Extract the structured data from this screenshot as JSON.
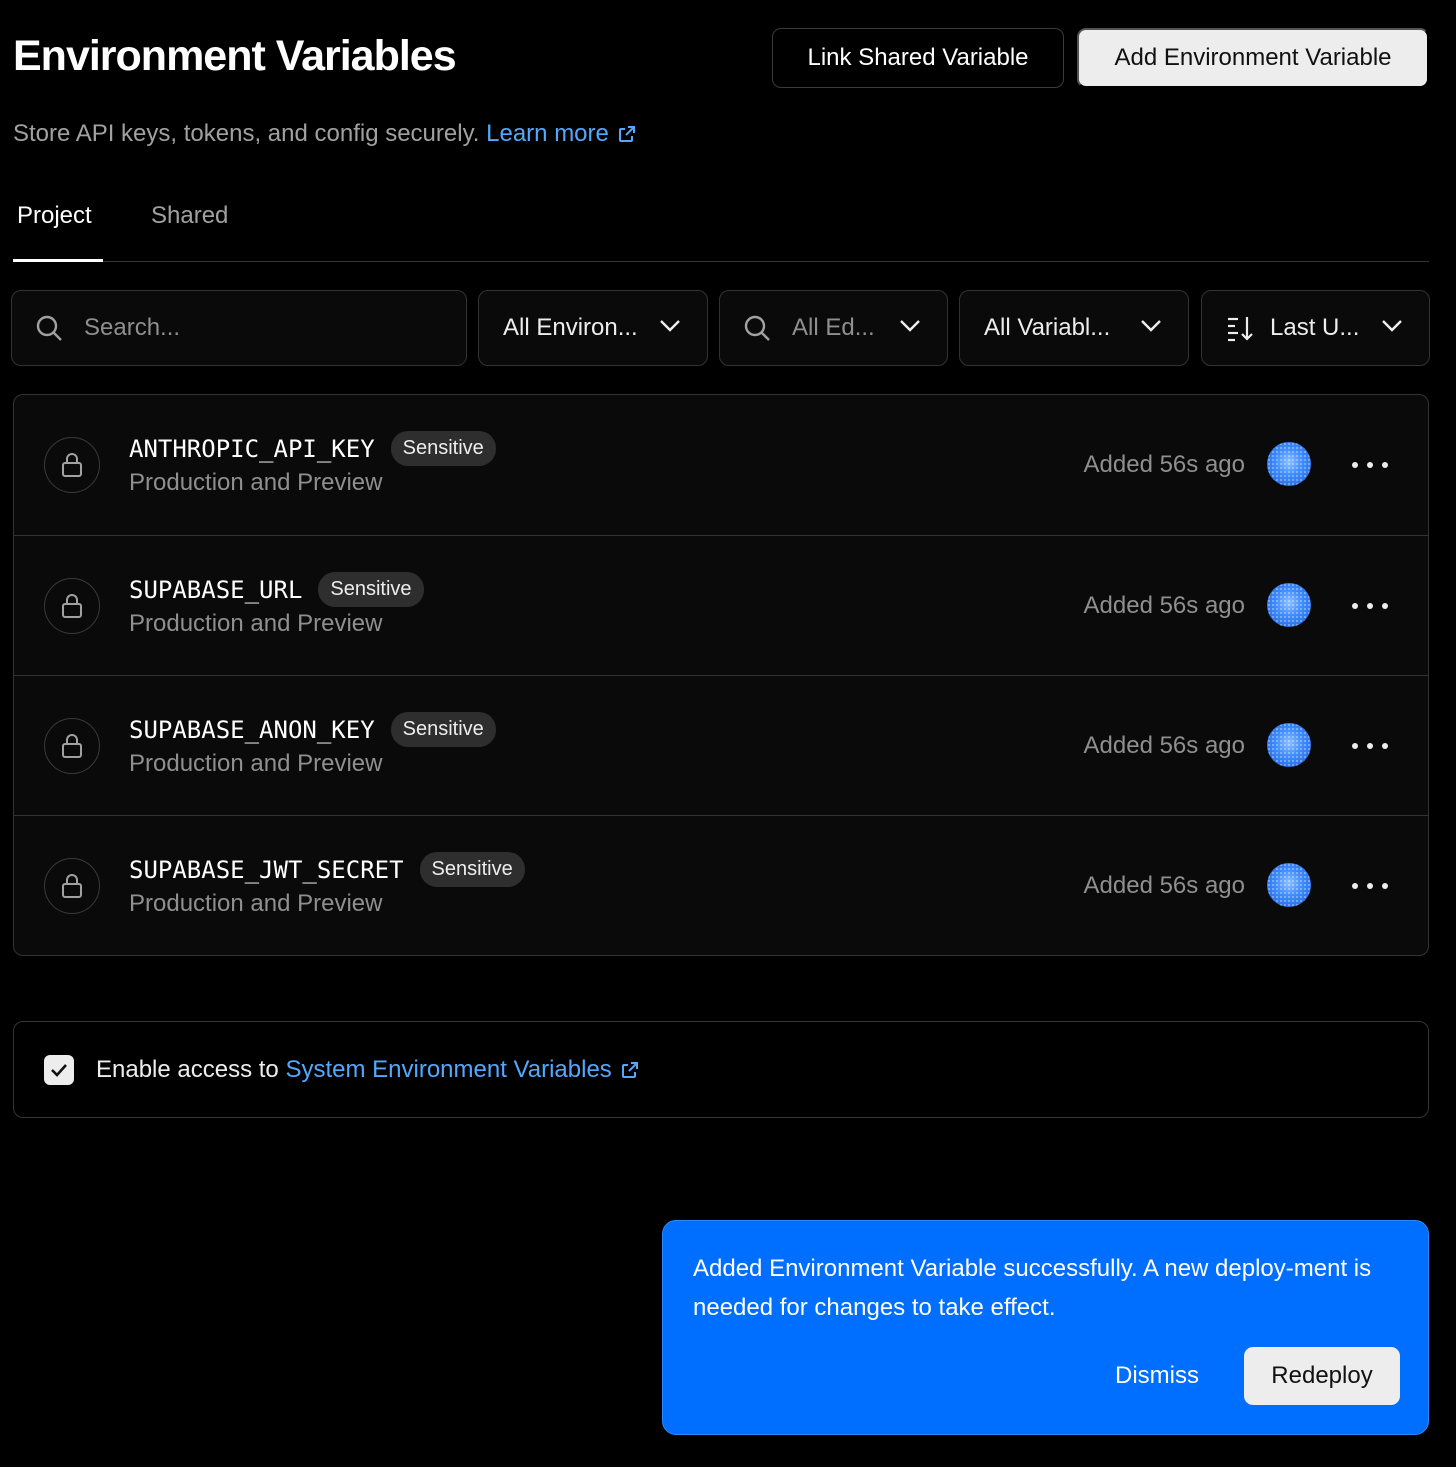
{
  "header": {
    "title": "Environment Variables",
    "link_shared_label": "Link Shared Variable",
    "add_label": "Add Environment Variable",
    "subtitle": "Store API keys, tokens, and config securely.",
    "learn_more": "Learn more"
  },
  "tabs": [
    {
      "label": "Project",
      "active": true
    },
    {
      "label": "Shared",
      "active": false
    }
  ],
  "filters": {
    "search_placeholder": "Search...",
    "environment": "All Environ...",
    "edge": "All Ed...",
    "variables": "All Variabl...",
    "sort": "Last U..."
  },
  "variables": [
    {
      "name": "ANTHROPIC_API_KEY",
      "badge": "Sensitive",
      "environments": "Production and Preview",
      "added": "Added 56s ago"
    },
    {
      "name": "SUPABASE_URL",
      "badge": "Sensitive",
      "environments": "Production and Preview",
      "added": "Added 56s ago"
    },
    {
      "name": "SUPABASE_ANON_KEY",
      "badge": "Sensitive",
      "environments": "Production and Preview",
      "added": "Added 56s ago"
    },
    {
      "name": "SUPABASE_JWT_SECRET",
      "badge": "Sensitive",
      "environments": "Production and Preview",
      "added": "Added 56s ago"
    }
  ],
  "system_access": {
    "prefix": "Enable access to",
    "link": "System Environment Variables",
    "checked": true
  },
  "toast": {
    "message": "Added Environment Variable successfully. A new deploy-ment is needed for changes to take effect.",
    "dismiss_label": "Dismiss",
    "redeploy_label": "Redeploy"
  },
  "icons": {
    "lock": "lock-icon",
    "search": "search-icon",
    "chevron": "chevron-down-icon",
    "sort": "sort-icon",
    "more": "more-horizontal-icon",
    "external": "external-link-icon",
    "check": "check-icon"
  },
  "colors": {
    "background": "#000000",
    "link": "#52a8ff",
    "toast": "#006efe"
  }
}
